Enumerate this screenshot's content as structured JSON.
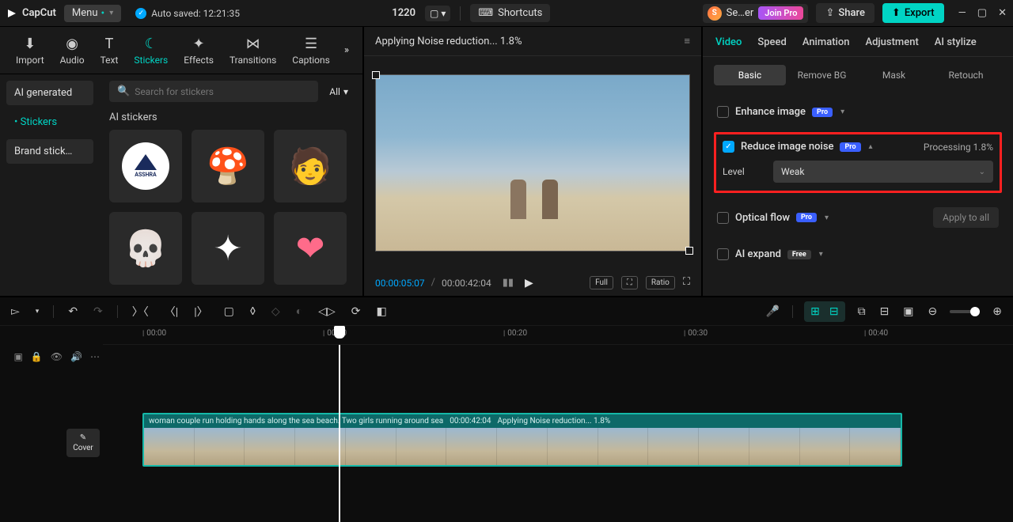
{
  "topbar": {
    "app_name": "CapCut",
    "menu_label": "Menu",
    "auto_saved": "Auto saved: 12:21:35",
    "project_name": "1220",
    "shortcuts_label": "Shortcuts",
    "user_short": "S",
    "user_label": "Se…er",
    "join_pro": "Join Pro",
    "share_label": "Share",
    "export_label": "Export"
  },
  "tools": {
    "import": "Import",
    "audio": "Audio",
    "text": "Text",
    "stickers": "Stickers",
    "effects": "Effects",
    "transitions": "Transitions",
    "captions": "Captions"
  },
  "side_nav": {
    "ai_generated": "AI generated",
    "stickers": "Stickers",
    "brand_stickers": "Brand stick…"
  },
  "sticker_panel": {
    "search_placeholder": "Search for stickers",
    "all_label": "All",
    "section_title": "AI stickers",
    "asshra": "ASSHRA"
  },
  "preview": {
    "title": "Applying Noise reduction... 1.8%",
    "time_current": "00:00:05:07",
    "time_total": "00:00:42:04",
    "full": "Full",
    "ratio": "Ratio"
  },
  "right_panel": {
    "tabs": {
      "video": "Video",
      "speed": "Speed",
      "animation": "Animation",
      "adjustment": "Adjustment",
      "ai_stylize": "AI stylize"
    },
    "subtabs": {
      "basic": "Basic",
      "remove_bg": "Remove BG",
      "mask": "Mask",
      "retouch": "Retouch"
    },
    "enhance_image": "Enhance image",
    "reduce_noise": "Reduce image noise",
    "processing": "Processing 1.8%",
    "level_label": "Level",
    "level_value": "Weak",
    "optical_flow": "Optical flow",
    "apply_all": "Apply to all",
    "ai_expand": "AI expand",
    "pro": "Pro",
    "free": "Free"
  },
  "timeline": {
    "marks": [
      "00:00",
      "00:10",
      "00:20",
      "00:30",
      "00:40"
    ],
    "cover_label": "Cover",
    "clip_name": "woman couple run holding hands along the sea beach. Two girls running around sea",
    "clip_duration": "00:00:42:04",
    "clip_status": "Applying Noise reduction... 1.8%"
  }
}
